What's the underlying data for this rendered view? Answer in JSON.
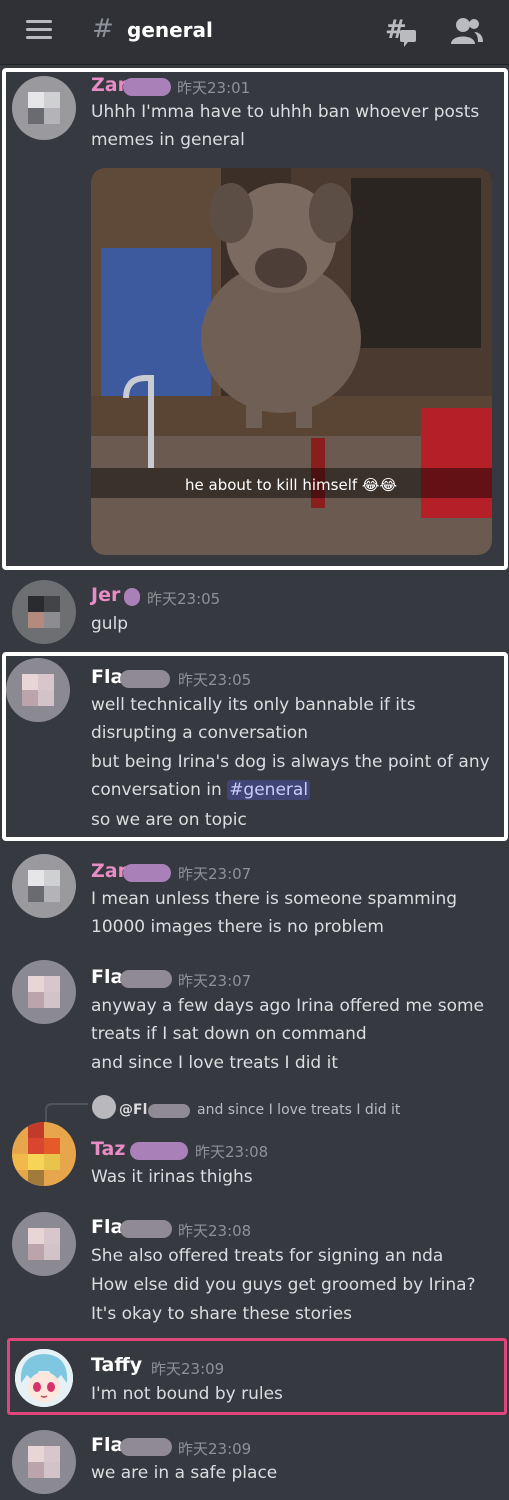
{
  "header": {
    "hash_symbol": "#",
    "channel_name": "general",
    "threads_icon": "threads-icon",
    "members_icon": "members-icon",
    "menu_icon": "hamburger-menu-icon"
  },
  "colors": {
    "background": "#36393f",
    "username_pink": "#e88cc5",
    "username_white": "#ffffff",
    "highlight_pink": "#e0467c",
    "mention_bg": "#5865f2"
  },
  "messages": [
    {
      "username": "Zar",
      "timestamp": "昨天23:01",
      "lines": [
        "Uhhh I'mma have to uhhh ban whoever posts",
        "memes in general"
      ],
      "image_caption": "he about to kill himself 😂😂"
    },
    {
      "username": "Jer",
      "timestamp": "昨天23:05",
      "lines": [
        "gulp"
      ]
    },
    {
      "username": "Fla",
      "timestamp": "昨天23:05",
      "lines": [
        "well technically its only bannable if its",
        "disrupting a conversation",
        "but being Irina's dog is always the point of any",
        "conversation in",
        "so we are on topic"
      ],
      "mention": "#general"
    },
    {
      "username": "Zar",
      "timestamp": "昨天23:07",
      "lines": [
        "I mean  unless there is someone spamming",
        "10000 images there is no problem"
      ]
    },
    {
      "username": "Fla",
      "timestamp": "昨天23:07",
      "lines": [
        "anyway a few days ago Irina offered me some",
        "treats if I sat down on command",
        "and since I love treats I did it"
      ]
    },
    {
      "reply_to": "@Fl",
      "reply_text": "and since I love treats I did it",
      "username": "Taz",
      "timestamp": "昨天23:08",
      "lines": [
        "Was it irinas thighs"
      ]
    },
    {
      "username": "Fla",
      "timestamp": "昨天23:08",
      "lines": [
        "She also offered treats for signing an nda",
        "How else did you guys get groomed by Irina?",
        "It's okay to share these stories"
      ]
    },
    {
      "username": "Taffy",
      "timestamp": "昨天23:09",
      "lines": [
        "I'm not bound by rules"
      ]
    },
    {
      "username": "Fla",
      "timestamp": "昨天23:09",
      "lines": [
        "we are in a safe place"
      ]
    }
  ]
}
